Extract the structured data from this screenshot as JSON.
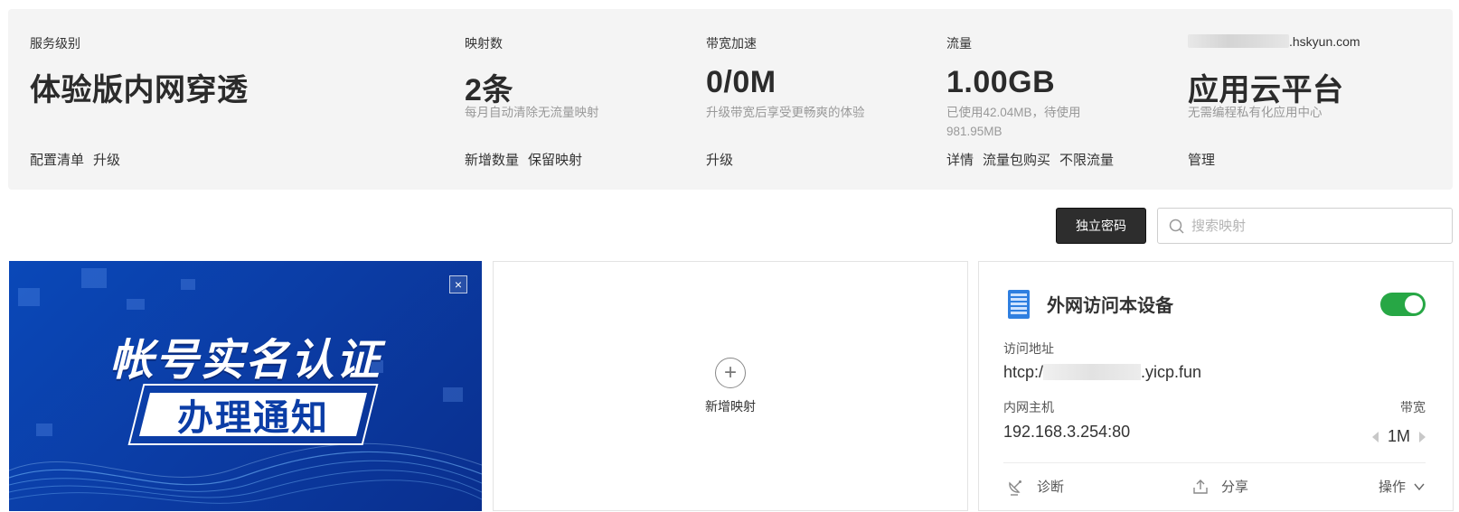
{
  "summary": {
    "service": {
      "label": "服务级别",
      "value": "体验版内网穿透",
      "actions": [
        "配置清单",
        "升级"
      ]
    },
    "mappings": {
      "label": "映射数",
      "value": "2条",
      "sub": "每月自动清除无流量映射",
      "actions": [
        "新增数量",
        "保留映射"
      ]
    },
    "bandwidth": {
      "label": "带宽加速",
      "value": "0/0M",
      "sub": "升级带宽后享受更畅爽的体验",
      "actions": [
        "升级"
      ]
    },
    "traffic": {
      "label": "流量",
      "value": "1.00GB",
      "sub_line1": "已使用42.04MB，待使用",
      "sub_line2": "981.95MB",
      "actions": [
        "详情",
        "流量包购买",
        "不限流量"
      ]
    },
    "cloud": {
      "domain_suffix": ".hskyun.com",
      "value": "应用云平台",
      "sub": "无需编程私有化应用中心",
      "actions": [
        "管理"
      ]
    }
  },
  "toolbar": {
    "password_button": "独立密码",
    "search_placeholder": "搜索映射"
  },
  "banner": {
    "title_top": "帐号实名认证",
    "title_bottom": "办理通知",
    "close": "×"
  },
  "add_card": {
    "label": "新增映射"
  },
  "mapping_card": {
    "title": "外网访问本设备",
    "enabled": true,
    "address_label": "访问地址",
    "address_prefix": "htcp:/",
    "address_suffix": ".yicp.fun",
    "host_label": "内网主机",
    "host_value": "192.168.3.254:80",
    "bandwidth_label": "带宽",
    "bandwidth_value": "1M",
    "diagnose": "诊断",
    "share": "分享",
    "operate": "操作"
  },
  "colors": {
    "toggle_on": "#27a745",
    "dark_button": "#2d2d2d",
    "banner_blue": "#0b3da6"
  }
}
